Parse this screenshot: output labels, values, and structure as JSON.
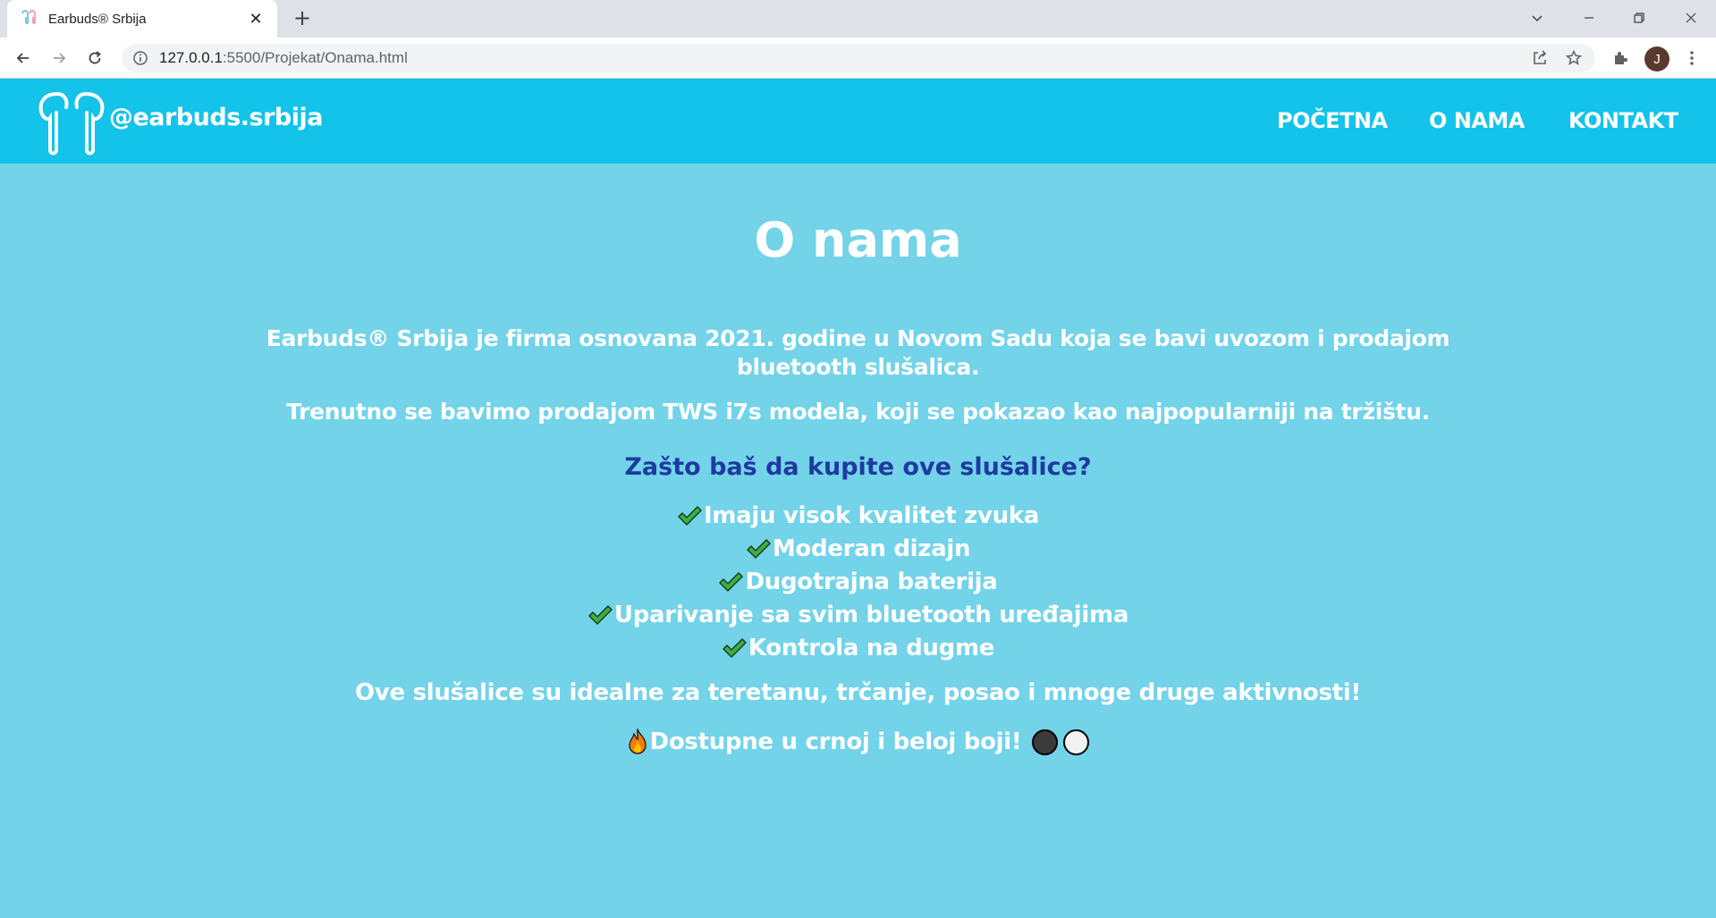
{
  "browser": {
    "tab_title": "Earbuds® Srbija",
    "url_host": "127.0.0.1",
    "url_path": ":5500/Projekat/Onama.html",
    "profile_initial": "J"
  },
  "header": {
    "logo_text": "@earbuds.srbija",
    "nav": [
      "POČETNA",
      "O NAMA",
      "KONTAKT"
    ]
  },
  "main": {
    "title": "O nama",
    "intro": "Earbuds® Srbija je firma osnovana 2021. godine u Novom Sadu koja se bavi uvozom i prodajom bluetooth slušalica.",
    "current": "Trenutno se bavimo prodajom TWS i7s modela, koji se pokazao kao najpopularniji na tržištu.",
    "why_heading": "Zašto baš da kupite ove slušalice?",
    "features": [
      "Imaju visok kvalitet zvuka",
      "Moderan dizajn",
      "Dugotrajna baterija",
      "Uparivanje sa svim bluetooth uređajima",
      "Kontrola na dugme"
    ],
    "ideal": "Ove slušalice su idealne za teretanu, trčanje, posao i mnoge druge aktivnosti!",
    "available": "Dostupne u crnoj i beloj boji!"
  },
  "colors": {
    "header_bg": "#13c3ea",
    "page_bg": "#72d3e9",
    "why_heading": "#1f3aa0",
    "check_green": "#3cb043",
    "dot_black": "#3b3b3b",
    "dot_white": "#f2f2f2"
  },
  "icons": [
    "earbuds-logo-icon",
    "check-icon",
    "fire-icon",
    "black-circle-icon",
    "white-circle-icon"
  ]
}
